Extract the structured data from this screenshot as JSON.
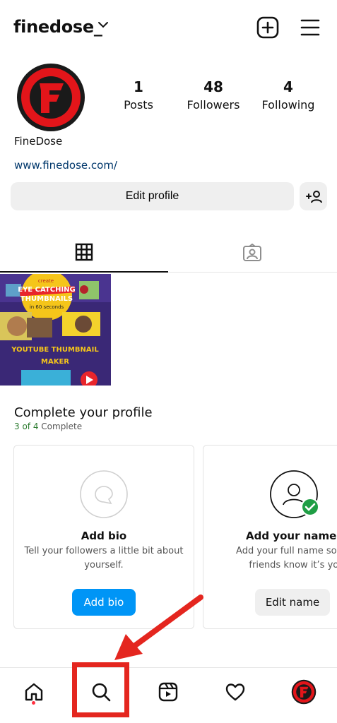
{
  "header": {
    "username": "finedose_",
    "icons": [
      "chevron-down-icon",
      "add-post-icon",
      "menu-icon"
    ]
  },
  "profile": {
    "avatar_letter": "F",
    "display_name": "FineDose",
    "website": "www.finedose.com/",
    "stats": [
      {
        "num": "1",
        "label": "Posts"
      },
      {
        "num": "48",
        "label": "Followers"
      },
      {
        "num": "4",
        "label": "Following"
      }
    ],
    "edit_profile_label": "Edit profile"
  },
  "post": {
    "line1": "create",
    "line2": "EYE CATCHING",
    "line3": "THUMBNAILS",
    "line4": "in 60 seconds",
    "line5": "YOUTUBE THUMBNAIL",
    "line6": "MAKER"
  },
  "complete_profile": {
    "title": "Complete your profile",
    "progress_done": "3 of 4",
    "progress_label": " Complete",
    "cards": [
      {
        "title": "Add bio",
        "desc": "Tell your followers a little bit about yourself.",
        "button": "Add bio"
      },
      {
        "title": "Add your name",
        "desc": "Add your full name so your friends know it’s you.",
        "button": "Edit name"
      }
    ]
  },
  "colors": {
    "accent": "#0095f6",
    "highlight": "#e4261f",
    "brand_red": "#e3151a"
  }
}
